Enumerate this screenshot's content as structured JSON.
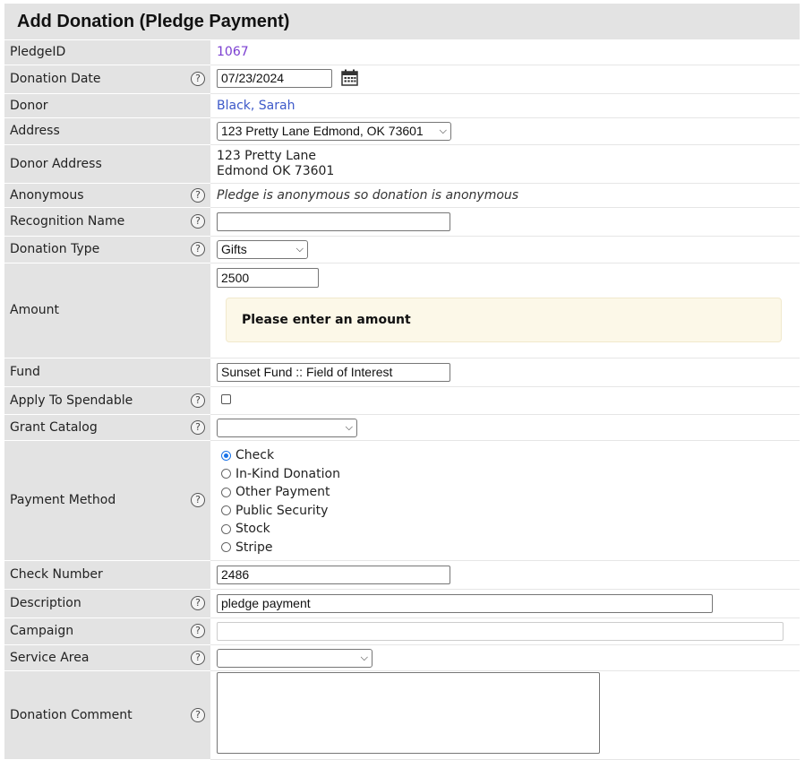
{
  "title": "Add Donation (Pledge Payment)",
  "help_glyph": "?",
  "fields": {
    "pledge_id": {
      "label": "PledgeID",
      "value": "1067"
    },
    "donation_date": {
      "label": "Donation Date",
      "value": "07/23/2024",
      "icon": "calendar-icon"
    },
    "donor": {
      "label": "Donor",
      "value": "Black, Sarah"
    },
    "address": {
      "label": "Address",
      "selected": "123 Pretty Lane Edmond, OK 73601"
    },
    "donor_address": {
      "label": "Donor Address",
      "line1": "123 Pretty Lane",
      "line2": "Edmond OK 73601"
    },
    "anonymous": {
      "label": "Anonymous",
      "value": "Pledge is anonymous so donation is anonymous"
    },
    "recognition_name": {
      "label": "Recognition Name",
      "value": ""
    },
    "donation_type": {
      "label": "Donation Type",
      "selected": "Gifts"
    },
    "amount": {
      "label": "Amount",
      "value": "2500",
      "warning": "Please enter an amount"
    },
    "fund": {
      "label": "Fund",
      "value": "Sunset Fund :: Field of Interest"
    },
    "apply_to_spendable": {
      "label": "Apply To Spendable",
      "checked": false
    },
    "grant_catalog": {
      "label": "Grant Catalog",
      "selected": ""
    },
    "payment_method": {
      "label": "Payment Method",
      "options": [
        "Check",
        "In-Kind Donation",
        "Other Payment",
        "Public Security",
        "Stock",
        "Stripe"
      ],
      "selected": "Check"
    },
    "check_number": {
      "label": "Check Number",
      "value": "2486"
    },
    "description": {
      "label": "Description",
      "value": "pledge payment"
    },
    "campaign": {
      "label": "Campaign",
      "value": ""
    },
    "service_area": {
      "label": "Service Area",
      "selected": ""
    },
    "donation_comment": {
      "label": "Donation Comment",
      "value": ""
    }
  },
  "colors": {
    "label_bg": "#e3e3e3",
    "link": "#3d59c9",
    "pledge_id": "#7b3fd1",
    "warning_bg": "#fcf8e8",
    "radio_accent": "#1a73e8"
  }
}
